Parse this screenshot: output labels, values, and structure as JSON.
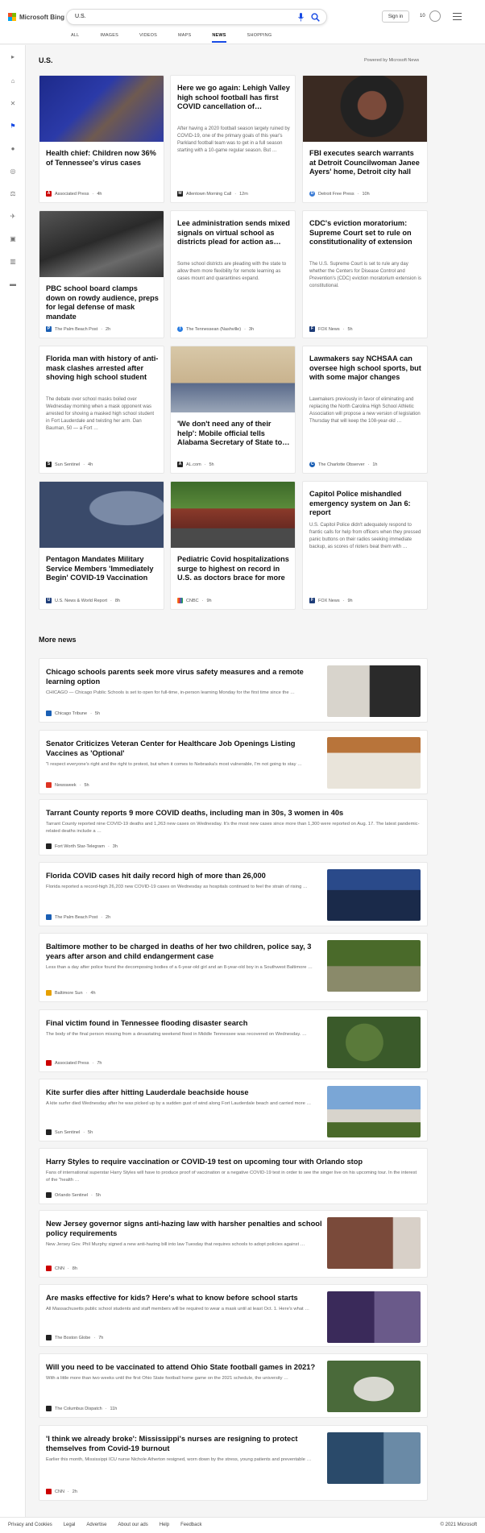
{
  "brand": {
    "name": "Microsoft Bing"
  },
  "search": {
    "query": "U.S."
  },
  "header": {
    "signin": "Sign in",
    "points": "10"
  },
  "tabs": [
    "ALL",
    "IMAGES",
    "VIDEOS",
    "MAPS",
    "NEWS",
    "SHOPPING"
  ],
  "section": {
    "title": "U.S.",
    "powered": "Powered by Microsoft News"
  },
  "cards": [
    {
      "title": "Health chief: Children now 36% of Tennessee's virus cases",
      "snippet": "",
      "source": "Associated Press",
      "time": "4h",
      "img": "photo"
    },
    {
      "title": "Here we go again: Lehigh Valley high school football has first COVID cancellation of…",
      "snippet": "After having a 2020 football season largely ruined by COVID-19, one of the primary goals of this year's Parkland football team was to get in a full season starting with a 10-game regular season. But …",
      "source": "Allentown Morning Call",
      "time": "12m",
      "img": ""
    },
    {
      "title": "FBI executes search warrants at Detroit Councilwoman Janee Ayers' home, Detroit city hall",
      "snippet": "",
      "source": "Detroit Free Press",
      "time": "10h",
      "img": "photo"
    },
    {
      "title": "PBC school board clamps down on rowdy audience, preps for legal defense of mask mandate",
      "snippet": "",
      "source": "The Palm Beach Post",
      "time": "2h",
      "img": "photo"
    },
    {
      "title": "Lee administration sends mixed signals on virtual school as districts plead for action as…",
      "snippet": "Some school districts are pleading with the state to allow them more flexibility for remote learning as cases mount and quarantines expand.",
      "source": "The Tennessean (Nashville)",
      "time": "3h",
      "img": ""
    },
    {
      "title": "CDC's eviction moratorium: Supreme Court set to rule on constitutionality of extension",
      "snippet": "The U.S. Supreme Court is set to rule any day whether the Centers for Disease Control and Prevention's (CDC) eviction moratorium extension is constitutional.",
      "source": "FOX News",
      "time": "5h",
      "img": ""
    },
    {
      "title": "Florida man with history of anti-mask clashes arrested after shoving high school student",
      "snippet": "The debate over school masks boiled over Wednesday morning when a mask opponent was arrested for shoving a masked high school student in Fort Lauderdale and twisting her arm. Dan Bauman, 50 — a Fort …",
      "source": "Sun Sentinel",
      "time": "4h",
      "img": ""
    },
    {
      "title": "'We don't need any of their help': Mobile official tells Alabama Secretary of State to…",
      "snippet": "",
      "source": "AL.com",
      "time": "5h",
      "img": "photo"
    },
    {
      "title": "Lawmakers say NCHSAA can oversee high school sports, but with some major changes",
      "snippet": "Lawmakers previously in favor of eliminating and replacing the North Carolina High School Athletic Association will propose a new version of legislation Thursday that will keep the 108-year-old …",
      "source": "The Charlotte Observer",
      "time": "1h",
      "img": ""
    },
    {
      "title": "Pentagon Mandates Military Service Members 'Immediately Begin' COVID-19 Vaccination",
      "snippet": "",
      "source": "U.S. News & World Report",
      "time": "8h",
      "img": "photo"
    },
    {
      "title": "Pediatric Covid hospitalizations surge to highest on record in U.S. as doctors brace for more",
      "snippet": "",
      "source": "CNBC",
      "time": "9h",
      "img": "photo"
    },
    {
      "title": "Capitol Police mishandled emergency system on Jan 6: report",
      "snippet": "U.S. Capitol Police didn't adequately respond to frantic calls for help from officers when they pressed panic buttons on their radios seeking immediate backup, as scores of rioters beat them with …",
      "source": "FOX News",
      "time": "9h",
      "img": ""
    }
  ],
  "more": {
    "title": "More news"
  },
  "news": [
    {
      "title": "Chicago schools parents seek more virus safety measures and a remote learning option",
      "snippet": "CHICAGO — Chicago Public Schools is set to open for full-time, in-person learning Monday for the first time since the …",
      "source": "Chicago Tribune",
      "time": "5h",
      "img": "photo"
    },
    {
      "title": "Senator Criticizes Veteran Center for Healthcare Job Openings Listing Vaccines as 'Optional'",
      "snippet": "\"I respect everyone's right and the right to protest, but when it comes to Nebraska's most vulnerable, I'm not going to stay …",
      "source": "Newsweek",
      "time": "5h",
      "img": "photo"
    },
    {
      "title": "Tarrant County reports 9 more COVID deaths, including man in 30s, 3 women in 40s",
      "snippet": "Tarrant County reported nine COVID-19 deaths and 1,263 new cases on Wednesday. It's the most new cases since more than 1,300 were reported on Aug. 17. The latest pandemic-related deaths include a …",
      "source": "Fort Worth Star-Telegram",
      "time": "3h",
      "img": ""
    },
    {
      "title": "Florida COVID cases hit daily record high of more than 26,000",
      "snippet": "Florida reported a record-high 26,203 new COVID-19 cases on Wednesday as hospitals continued to feel the strain of rising …",
      "source": "The Palm Beach Post",
      "time": "2h",
      "img": "photo"
    },
    {
      "title": "Baltimore mother to be charged in deaths of her two children, police say, 3 years after arson and child endangerment case",
      "snippet": "Less than a day after police found the decomposing bodies of a 6-year-old girl and an 8-year-old boy in a Southwest Baltimore …",
      "source": "Baltimore Sun",
      "time": "4h",
      "img": "photo"
    },
    {
      "title": "Final victim found in Tennessee flooding disaster search",
      "snippet": "The body of the final person missing from a devastating weekend flood in Middle Tennessee was recovered on Wednesday. …",
      "source": "Associated Press",
      "time": "7h",
      "img": "photo"
    },
    {
      "title": "Kite surfer dies after hitting Lauderdale beachside house",
      "snippet": "A kite surfer died Wednesday after he was picked up by a sudden gust of wind along Fort Lauderdale beach and carried more …",
      "source": "Sun Sentinel",
      "time": "5h",
      "img": "photo"
    },
    {
      "title": "Harry Styles to require vaccination or COVID-19 test on upcoming tour with Orlando stop",
      "snippet": "Fans of international superstar Harry Styles will have to produce proof of vaccination or a negative COVID-19 test in order to see the singer live on his upcoming tour. In the interest of the \"health …",
      "source": "Orlando Sentinel",
      "time": "5h",
      "img": ""
    },
    {
      "title": "New Jersey governor signs anti-hazing law with harsher penalties and school policy requirements",
      "snippet": "New Jersey Gov. Phil Murphy signed a new anti-hazing bill into law Tuesday that requires schools to adopt policies against …",
      "source": "CNN",
      "time": "8h",
      "img": "photo"
    },
    {
      "title": "Are masks effective for kids? Here's what to know before school starts",
      "snippet": "All Massachusetts public school students and staff members will be required to wear a mask until at least Oct. 1. Here's what …",
      "source": "The Boston Globe",
      "time": "7h",
      "img": "photo"
    },
    {
      "title": "Will you need to be vaccinated to attend Ohio State football games in 2021?",
      "snippet": "With a little more than two weeks until the first Ohio State football home game on the 2021 schedule, the university …",
      "source": "The Columbus Dispatch",
      "time": "11h",
      "img": "photo"
    },
    {
      "title": "'I think we already broke': Mississippi's nurses are resigning to protect themselves from Covid-19 burnout",
      "snippet": "Earlier this month, Mississippi ICU nurse Nichole Atherton resigned, worn down by the stress, young patients and preventable …",
      "source": "CNN",
      "time": "2h",
      "img": "photo"
    }
  ],
  "footer": {
    "links": [
      "Privacy and Cookies",
      "Legal",
      "Advertise",
      "About our ads",
      "Help",
      "Feedback"
    ],
    "copyright": "© 2021 Microsoft"
  },
  "colors": {
    "accent": "#174ae4",
    "bg": "#f5f5f5"
  },
  "icons": [
    "microsoft-logo-icon",
    "mic-icon",
    "search-icon",
    "rewards-icon",
    "hamburger-menu-icon"
  ]
}
